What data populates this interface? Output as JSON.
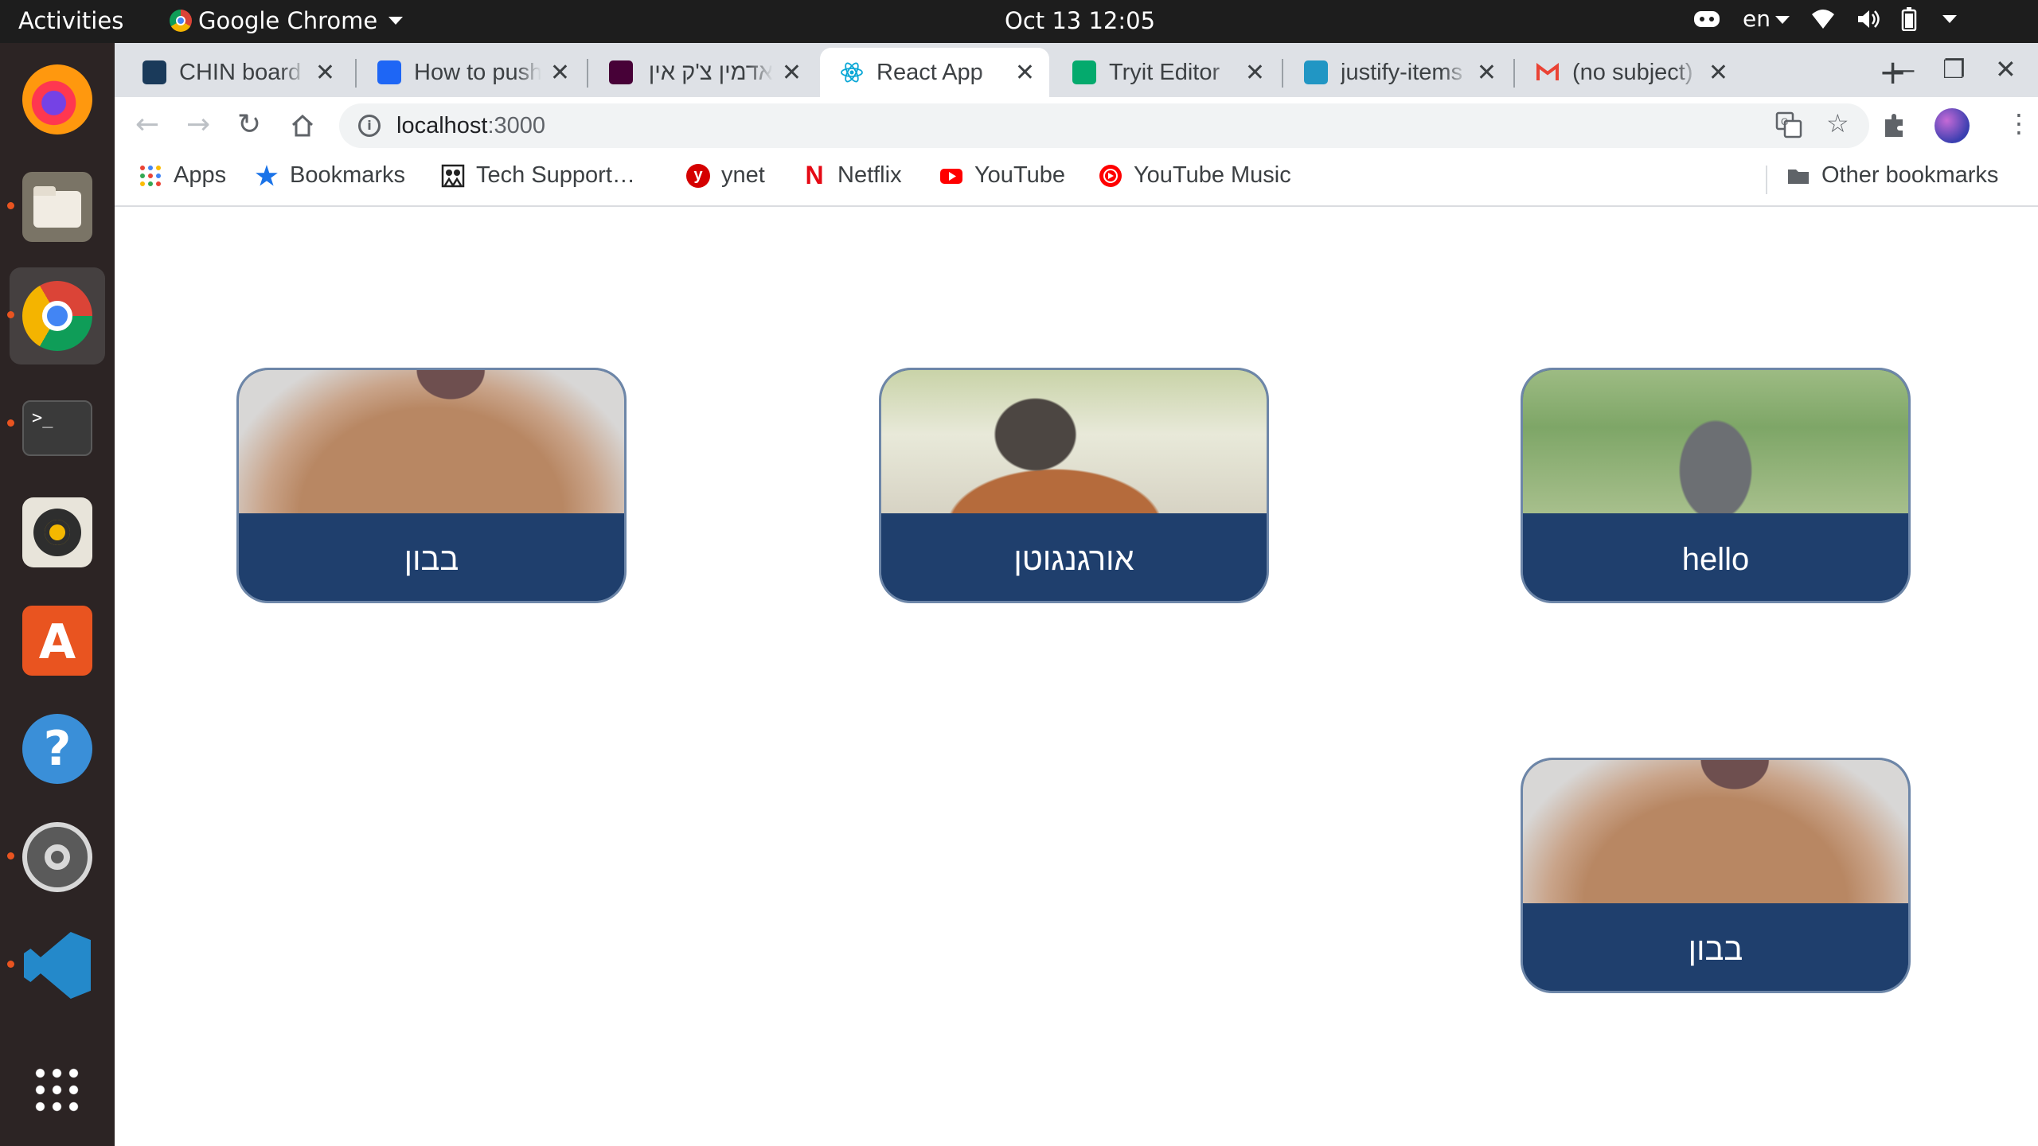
{
  "topbar": {
    "activities": "Activities",
    "app_name": "Google Chrome",
    "clock": "Oct 13  12:05",
    "language": "en"
  },
  "dock": {
    "items": [
      "firefox-icon",
      "files-icon",
      "chrome-icon",
      "terminal-icon",
      "rhythmbox-icon",
      "software-store-icon",
      "help-icon",
      "settings-icon",
      "vscode-icon",
      "show-apps-icon"
    ],
    "terminal_glyph": ">_"
  },
  "tabs": [
    {
      "title": "CHIN board",
      "favicon_color": "#1a3a5a"
    },
    {
      "title": "How to push",
      "favicon_color": "#1e66f5"
    },
    {
      "title": "אדמין צ'ק אין",
      "favicon_color": "#470137"
    },
    {
      "title": "React App",
      "favicon_color": "#61dafb"
    },
    {
      "title": "Tryit Editor",
      "favicon_color": "#04aa6d"
    },
    {
      "title": "justify-items",
      "favicon_color": "#2196c4"
    },
    {
      "title": "(no subject)",
      "favicon_color": "#ea4335"
    }
  ],
  "toolbar": {
    "url_host": "localhost",
    "url_port": ":3000"
  },
  "bookmarks": {
    "items": [
      {
        "label": "Apps",
        "icon": "apps-grid-icon"
      },
      {
        "label": "Bookmarks",
        "icon": "star-icon"
      },
      {
        "label": "Tech Support…",
        "icon": "tech-support-icon"
      },
      {
        "label": "ynet",
        "icon": "ynet-icon"
      },
      {
        "label": "Netflix",
        "icon": "netflix-icon"
      },
      {
        "label": "YouTube",
        "icon": "youtube-icon"
      },
      {
        "label": "YouTube Music",
        "icon": "youtube-music-icon"
      }
    ],
    "other": "Other bookmarks",
    "ynet_glyph": "y",
    "netflix_glyph": "N"
  },
  "cards": [
    {
      "label": "בבון",
      "photo": "baboon"
    },
    {
      "label": "אורגנגוטן",
      "photo": "orangutan"
    },
    {
      "label": "hello",
      "photo": "gorilla"
    },
    {
      "label": "בבון",
      "photo": "baboon"
    }
  ],
  "colors": {
    "card_caption": "#1f3f6d",
    "card_border": "#6d86a8",
    "accent_orange": "#e95420"
  }
}
